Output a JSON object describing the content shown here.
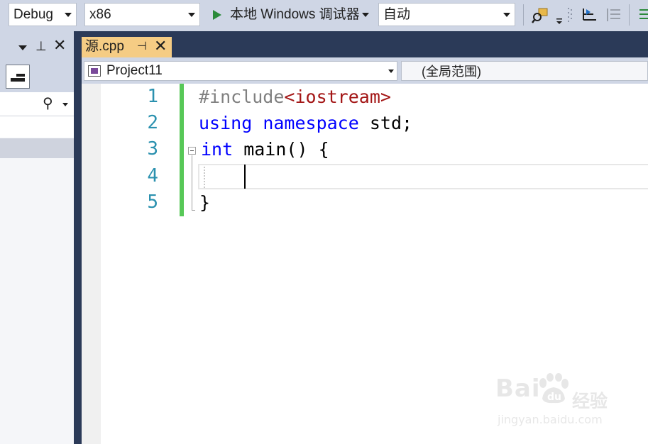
{
  "toolbar": {
    "configuration": "Debug",
    "platform": "x86",
    "run_label": "本地 Windows 调试器",
    "target": "自动"
  },
  "tab": {
    "file_name": "源.cpp"
  },
  "navbar": {
    "project": "Project11",
    "scope": "(全局范围)"
  },
  "editor": {
    "line_numbers": [
      "1",
      "2",
      "3",
      "4",
      "5"
    ],
    "lines": {
      "l1_directive": "#include",
      "l1_header": "<iostream>",
      "l2_using": "using",
      "l2_namespace": "namespace",
      "l2_rest": " std;",
      "l3_int": "int",
      "l3_rest": " main() {",
      "l4": "",
      "l5": "}"
    }
  },
  "watermark": {
    "brand_left": "Bai",
    "brand_right": "du",
    "brand_cn": "经验",
    "url": "jingyan.baidu.com"
  },
  "colors": {
    "tab_active": "#f5cc84",
    "change_bar": "#57c857",
    "line_number": "#2b91af",
    "keyword": "#0000ff",
    "string": "#a31515"
  }
}
